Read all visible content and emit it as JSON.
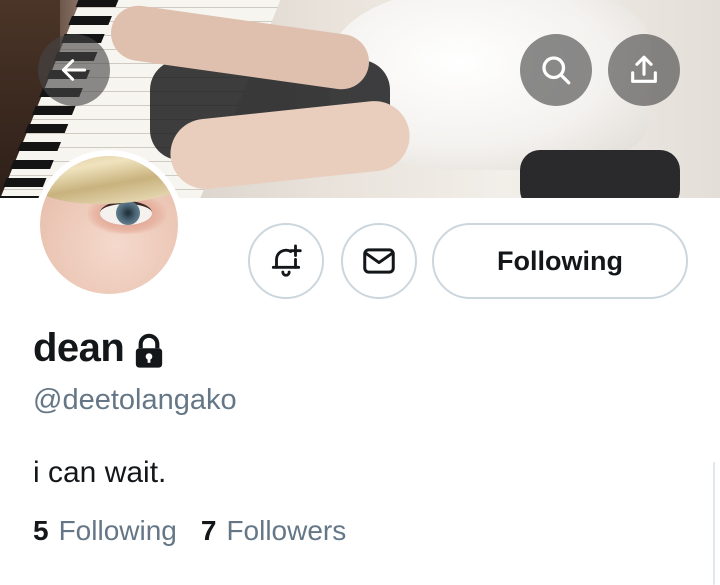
{
  "header": {
    "back_icon": "arrow-left-icon",
    "search_icon": "search-icon",
    "share_icon": "share-icon"
  },
  "profile": {
    "display_name": "dean",
    "protected_icon": "lock-icon",
    "handle": "@deetolangako",
    "bio": "i can wait.",
    "avatar_icon": "avatar"
  },
  "actions": {
    "notify_icon": "bell-plus-icon",
    "message_icon": "envelope-icon",
    "following_label": "Following"
  },
  "stats": {
    "following_count": "5",
    "following_label": "Following",
    "followers_count": "7",
    "followers_label": "Followers"
  },
  "colors": {
    "text_primary": "#14171a",
    "text_secondary": "#657786",
    "border": "#ccd6dd",
    "overlay_button": "#464646"
  }
}
